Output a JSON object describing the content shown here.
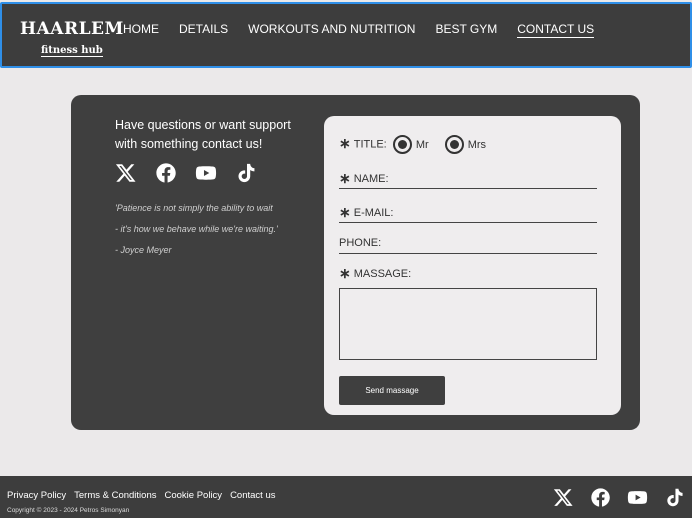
{
  "header": {
    "logo_main": "HAARLEM",
    "logo_sub": "fitness hub",
    "nav": [
      "HOME",
      "DETAILS",
      "WORKOUTS AND NUTRITION",
      "BEST GYM",
      "CONTACT US"
    ]
  },
  "contact": {
    "intro": "Have questions or want support with something contact us!",
    "quote_line1": "'Patience is not simply the ability to wait",
    "quote_line2": "- it's how we behave while we're waiting.'",
    "quote_author": "- Joyce Meyer"
  },
  "form": {
    "required_mark": "∗",
    "title_label": "TITLE:",
    "option_mr": "Mr",
    "option_mrs": "Mrs",
    "name_label": "NAME:",
    "email_label": "E-MAIL:",
    "phone_label": "PHONE:",
    "message_label": "MASSAGE:",
    "send_label": "Send massage"
  },
  "footer": {
    "links": [
      "Privacy Policy",
      "Terms & Conditions",
      "Cookie Policy",
      "Contact us"
    ],
    "copyright": "Copyright © 2023 - 2024 Petros Simonyan"
  },
  "colors": {
    "background": "#ebe9ea",
    "dark": "#3d3d3d",
    "header_border": "#2f8fe8"
  },
  "icons": [
    "x-icon",
    "facebook-icon",
    "youtube-icon",
    "tiktok-icon"
  ]
}
